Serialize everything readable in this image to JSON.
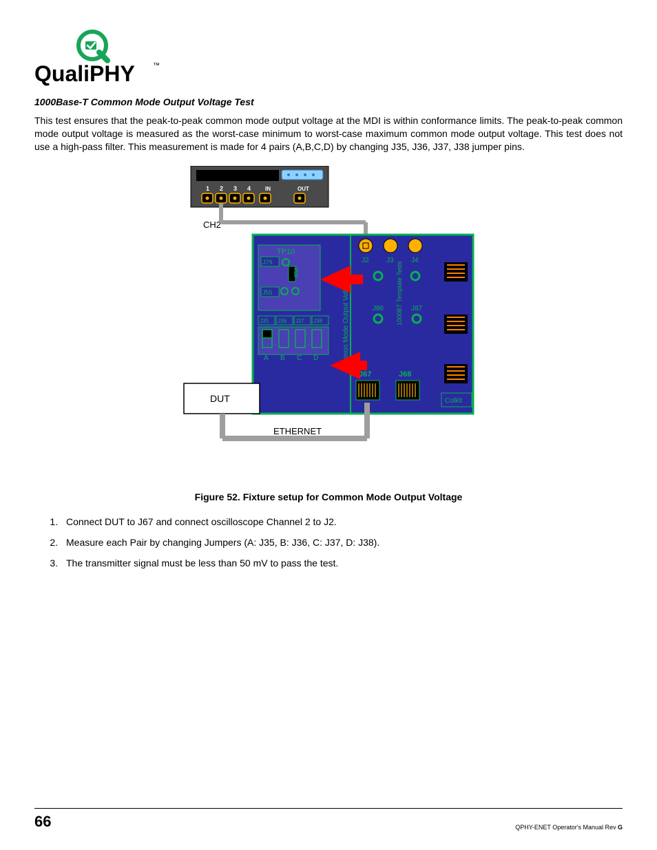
{
  "logo": {
    "brand": "QualiPHY",
    "tm": "™",
    "accent": "#18a558",
    "text_color": "#000"
  },
  "section_heading": "1000Base-T Common Mode Output Voltage Test",
  "paragraph": "This test ensures that the peak-to-peak common mode output voltage at the MDI is within conformance limits. The peak-to-peak common mode output voltage is measured as the worst-case minimum to worst-case maximum common mode output voltage. This test does not use a high-pass filter. This measurement is made for 4 pairs (A,B,C,D) by changing J35, J36, J37, J38 jumper pins.",
  "figure_caption": "Figure 52. Fixture setup for Common Mode Output Voltage",
  "steps": [
    "Connect DUT to J67 and connect oscilloscope Channel 2 to J2.",
    "Measure each Pair by changing Jumpers (A: J35, B: J36, C: J37, D: J38).",
    "The transmitter signal must be less than 50 mV to pass the test."
  ],
  "diagram": {
    "scope": {
      "channel_labels": [
        "1",
        "2",
        "3",
        "4"
      ],
      "in_label": "IN",
      "out_label": "OUT"
    },
    "ch2_label": "CH2",
    "board": {
      "tp_label": "TP10",
      "j79_label": "J79",
      "r_label": "R50",
      "j55_label": "J55",
      "jumper_row": [
        "J35",
        "J36",
        "J37",
        "J38"
      ],
      "pair_letters": [
        "A",
        "B",
        "C",
        "D"
      ],
      "right_top_jacks": [
        "J2",
        "J3",
        "J4"
      ],
      "right_mid_jacks": [
        "J86",
        "J87"
      ],
      "right_bottom_jacks": [
        "J67",
        "J68"
      ],
      "vert_label_left": "Common Mode Output Voltage",
      "vert_label_right": "1000BT Template Tests",
      "colkit_label": "Colkit"
    },
    "dut_label": "DUT",
    "ethernet_label": "ETHERNET"
  },
  "footer": {
    "page_number": "66",
    "manual_text_prefix": "QPHY-ENET Operator's Manual Rev ",
    "manual_rev": "G"
  }
}
